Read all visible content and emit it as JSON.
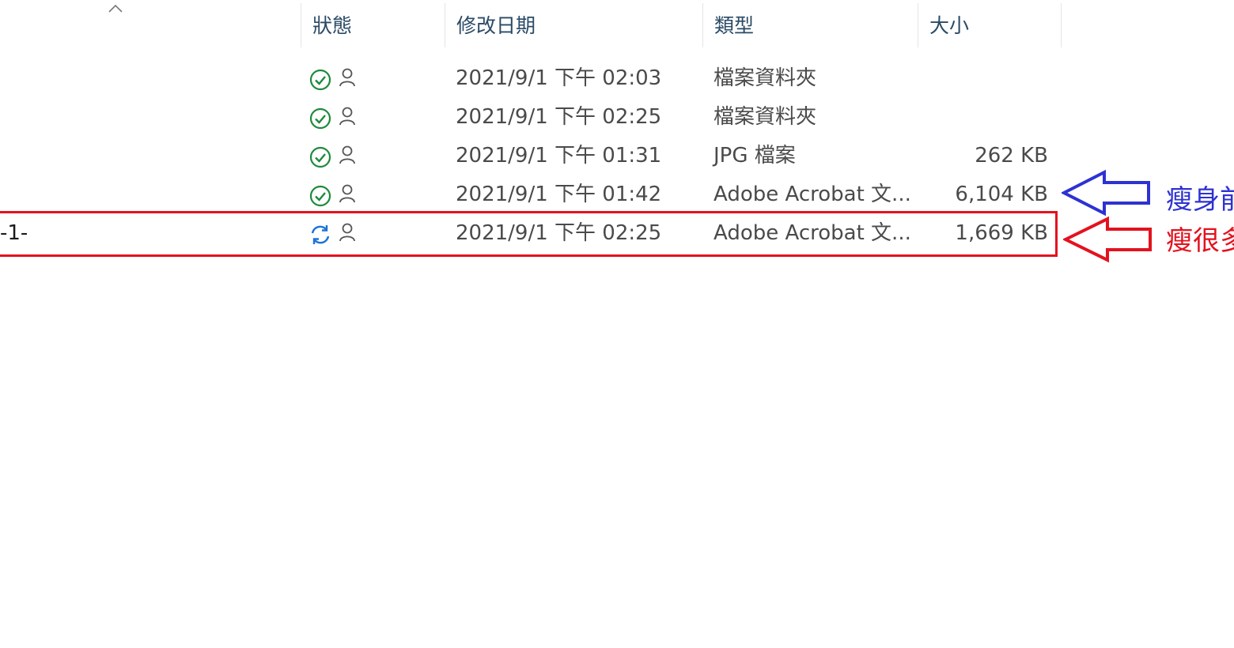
{
  "columns": {
    "status": "狀態",
    "modified": "修改日期",
    "type": "類型",
    "size": "大小"
  },
  "rows": [
    {
      "name": "",
      "status": "synced",
      "modified": "2021/9/1 下午 02:03",
      "type": "檔案資料夾",
      "size": ""
    },
    {
      "name": "",
      "status": "synced",
      "modified": "2021/9/1 下午 02:25",
      "type": "檔案資料夾",
      "size": ""
    },
    {
      "name": "",
      "status": "synced",
      "modified": "2021/9/1 下午 01:31",
      "type": "JPG 檔案",
      "size": "262 KB"
    },
    {
      "name": "",
      "status": "synced",
      "modified": "2021/9/1 下午 01:42",
      "type": "Adobe Acrobat 文...",
      "size": "6,104 KB"
    },
    {
      "name": "-1-",
      "status": "syncing",
      "modified": "2021/9/1 下午 02:25",
      "type": "Adobe Acrobat 文...",
      "size": "1,669 KB"
    }
  ],
  "annotations": {
    "before_note": "瘦身前",
    "after_note": "瘦很多",
    "before_color": "#2d32d2",
    "after_color": "#e3121e"
  },
  "colors": {
    "synced_icon": "#1e8a3c",
    "syncing_icon": "#1a73d8",
    "shared_icon": "#555555"
  }
}
